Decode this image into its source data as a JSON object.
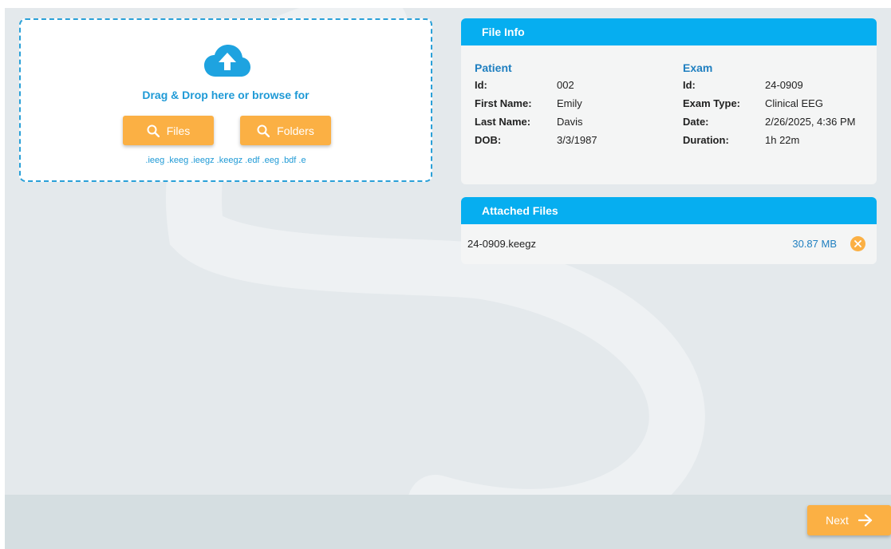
{
  "dropzone": {
    "prompt": "Drag & Drop here or browse for",
    "files_button": "Files",
    "folders_button": "Folders",
    "extensions": ".ieeg .keeg .ieegz .keegz .edf .eeg .bdf .e"
  },
  "file_info": {
    "title": "File Info",
    "patient": {
      "heading": "Patient",
      "rows": [
        {
          "label": "Id:",
          "value": "002"
        },
        {
          "label": "First Name:",
          "value": "Emily"
        },
        {
          "label": "Last Name:",
          "value": "Davis"
        },
        {
          "label": "DOB:",
          "value": "3/3/1987"
        }
      ]
    },
    "exam": {
      "heading": "Exam",
      "rows": [
        {
          "label": "Id:",
          "value": "24-0909"
        },
        {
          "label": "Exam Type:",
          "value": "Clinical EEG"
        },
        {
          "label": "Date:",
          "value": "2/26/2025, 4:36 PM"
        },
        {
          "label": "Duration:",
          "value": "1h 22m"
        }
      ]
    }
  },
  "attached_files": {
    "title": "Attached Files",
    "files": [
      {
        "name": "24-0909.keegz",
        "size": "30.87 MB"
      }
    ]
  },
  "footer": {
    "next_label": "Next"
  },
  "colors": {
    "accent_blue": "#06aef0",
    "text_blue": "#1f9ad6",
    "action_orange": "#fbb044",
    "background": "#e4e9ec"
  },
  "icons": {
    "upload": "cloud-upload-icon",
    "search": "search-icon",
    "remove": "close-circle-icon",
    "next": "arrow-right-icon"
  }
}
